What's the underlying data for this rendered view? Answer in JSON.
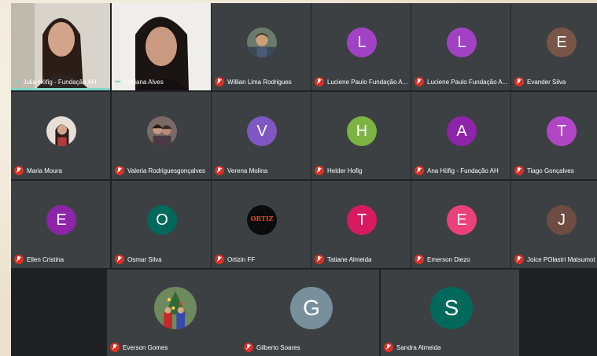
{
  "meeting": {
    "colors": {
      "background": "#202124",
      "tile": "#3c4043",
      "mic_muted": "#d93025",
      "active_speaker": "#7fd7c4"
    },
    "video_participants": [
      {
        "name": "Julia Höfig - Fundação AH",
        "active": true
      },
      {
        "name": "Fabiana Alves",
        "active": false
      }
    ],
    "participants": [
      {
        "name": "Willian Lima Rodrigues",
        "avatar": "photo"
      },
      {
        "name": "Luciene Paulo Fundação A...",
        "avatar": "letter",
        "initial": "L",
        "color": "#a142c4"
      },
      {
        "name": "Luciene Paulo Fundação A...",
        "avatar": "letter",
        "initial": "L",
        "color": "#a142c4"
      },
      {
        "name": "Evander Silva",
        "avatar": "letter",
        "initial": "E",
        "color": "#795548"
      },
      {
        "name": "Maria Moura",
        "avatar": "photo"
      },
      {
        "name": "Valeria Rodriguesgonçalves",
        "avatar": "photo"
      },
      {
        "name": "Verena Molina",
        "avatar": "letter",
        "initial": "V",
        "color": "#7e57c2"
      },
      {
        "name": "Helder Hofig",
        "avatar": "letter",
        "initial": "H",
        "color": "#7cb342"
      },
      {
        "name": "Ana Höfig - Fundação AH",
        "avatar": "letter",
        "initial": "A",
        "color": "#8e24aa"
      },
      {
        "name": "Tiago Gonçalves",
        "avatar": "letter",
        "initial": "T",
        "color": "#b046c6"
      },
      {
        "name": "Ellen Cristina",
        "avatar": "letter",
        "initial": "E",
        "color": "#8e24aa"
      },
      {
        "name": "Osmar Silva",
        "avatar": "letter",
        "initial": "O",
        "color": "#00695c"
      },
      {
        "name": "Ortizin FF",
        "avatar": "logo",
        "logo_text": "ORTIZ"
      },
      {
        "name": "Tatiane Almeida",
        "avatar": "letter",
        "initial": "T",
        "color": "#d81b60"
      },
      {
        "name": "Emerson Diezo",
        "avatar": "letter",
        "initial": "E",
        "color": "#ec407a"
      },
      {
        "name": "Joice POlastri Matsumoto",
        "avatar": "letter",
        "initial": "J",
        "color": "#6d4c41"
      }
    ],
    "bottom_participants": [
      {
        "name": "Everson Gomes",
        "avatar": "photo"
      },
      {
        "name": "Gilberto Soares",
        "avatar": "letter",
        "initial": "G",
        "color": "#78909c"
      },
      {
        "name": "Sandra Almeida",
        "avatar": "letter",
        "initial": "S",
        "color": "#00695c"
      }
    ]
  }
}
